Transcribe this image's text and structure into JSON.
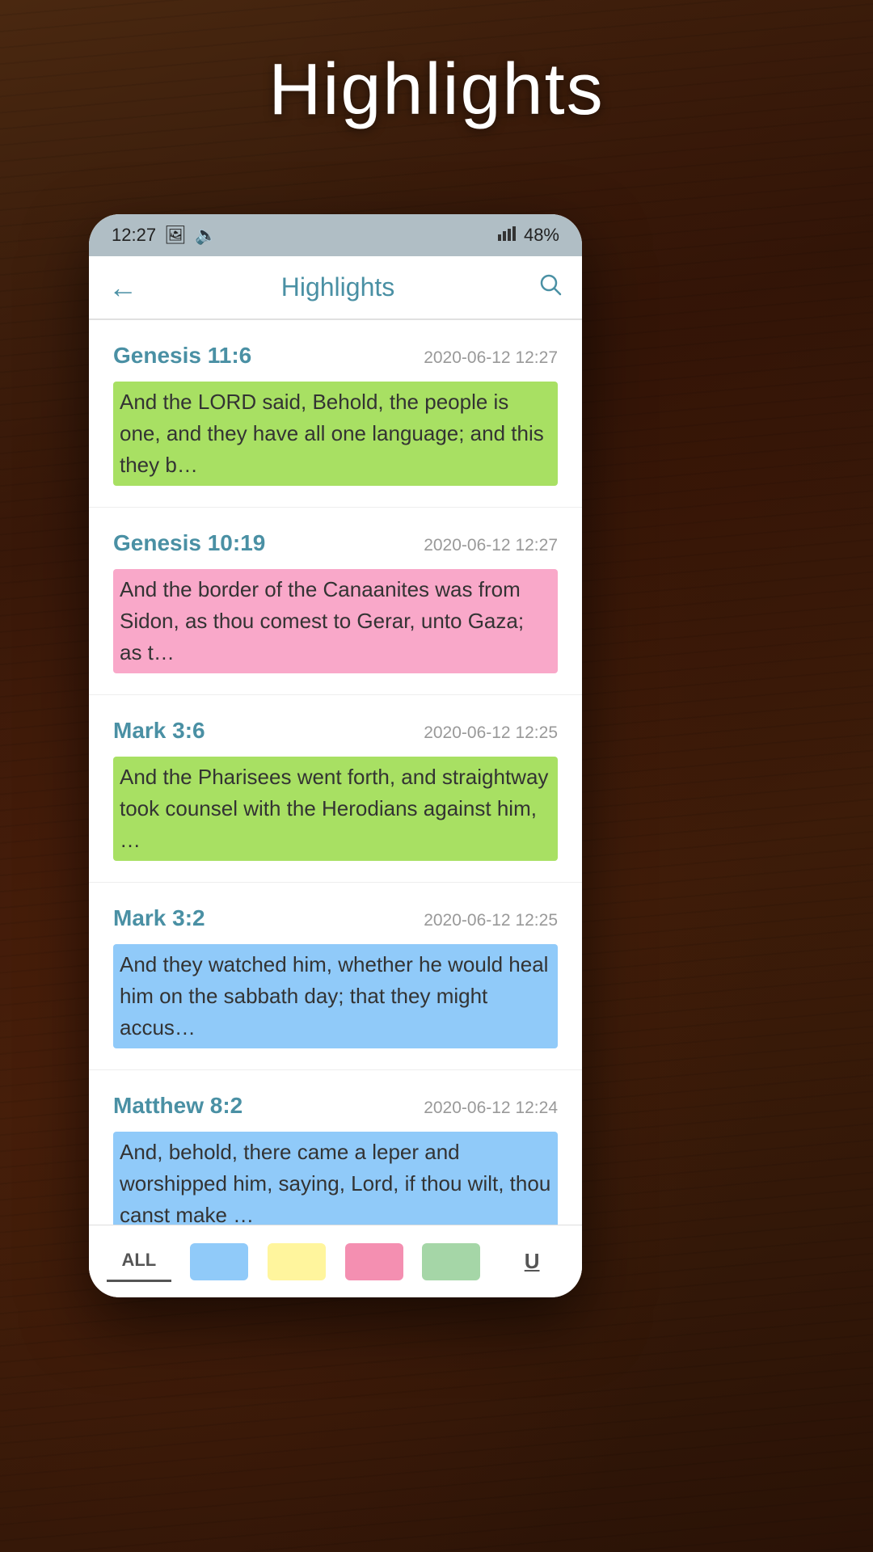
{
  "page": {
    "title": "Highlights",
    "background": "#3a1f0d"
  },
  "status_bar": {
    "time": "12:27",
    "battery": "48%",
    "signal": "signal-icon",
    "photo_icon": "🖼",
    "bluetooth_icon": "🔊"
  },
  "header": {
    "back_label": "←",
    "title": "Highlights",
    "search_label": "🔍"
  },
  "highlights": [
    {
      "reference": "Genesis 11:6",
      "date": "2020-06-12 12:27",
      "text": "And the LORD said, Behold, the people is one, and they have all one language; and this they b…",
      "highlight_color": "green"
    },
    {
      "reference": "Genesis 10:19",
      "date": "2020-06-12 12:27",
      "text": "And the border of the Canaanites was from Sidon, as thou comest to Gerar, unto Gaza; as t…",
      "highlight_color": "pink"
    },
    {
      "reference": "Mark 3:6",
      "date": "2020-06-12 12:25",
      "text": "And the Pharisees went forth, and straightway took counsel with the Herodians against him, …",
      "highlight_color": "green"
    },
    {
      "reference": "Mark 3:2",
      "date": "2020-06-12 12:25",
      "text": "And they watched him, whether he would heal him on the sabbath day; that they might accus…",
      "highlight_color": "blue"
    },
    {
      "reference": "Matthew 8:2",
      "date": "2020-06-12 12:24",
      "text": "And, behold, there came a leper and worshipped him, saying, Lord, if thou wilt, thou canst make …",
      "highlight_color": "blue"
    }
  ],
  "bottom_bar": {
    "all_label": "ALL",
    "underline_label": "U",
    "tabs": [
      "all",
      "blue",
      "yellow",
      "pink",
      "green",
      "underline"
    ]
  }
}
